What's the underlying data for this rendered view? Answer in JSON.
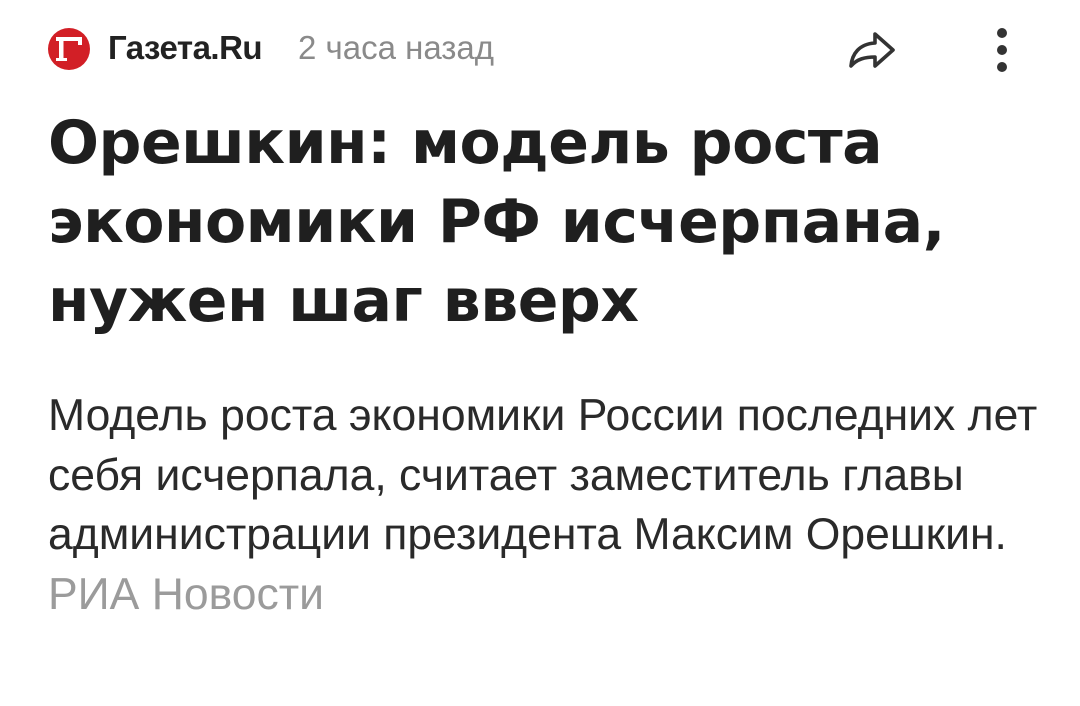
{
  "header": {
    "source_logo_letter": "Г",
    "source_name": "Газета.Ru",
    "time_ago": "2 часа назад",
    "logo_color": "#d21f26",
    "share_icon": "share-arrow-icon",
    "more_icon": "more-vertical-icon"
  },
  "article": {
    "headline": "Орешкин: модель роста экономики РФ исчерпана, нужен шаг вверх",
    "summary": "Модель роста экономики России последних лет себя исчерпала, считает заместитель главы администрации президента Максим Орешкин.",
    "summary_source": "РИА Новости"
  }
}
